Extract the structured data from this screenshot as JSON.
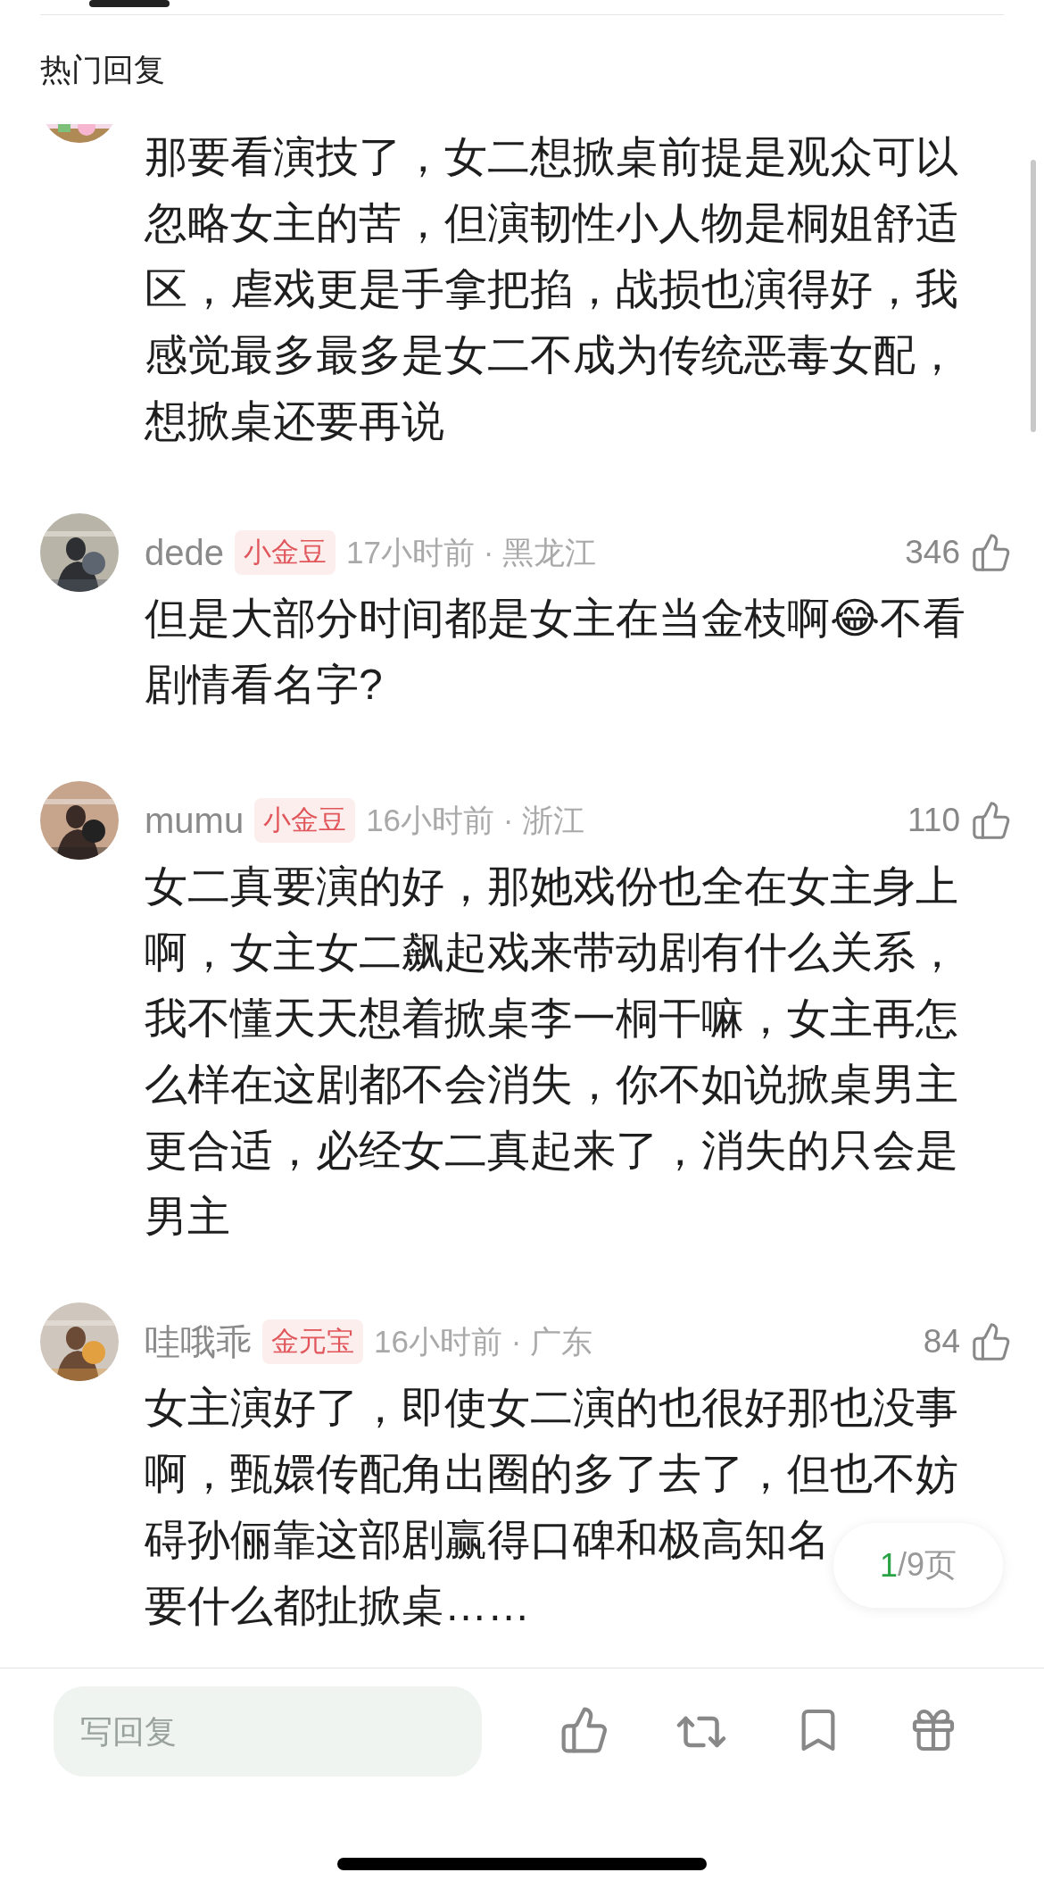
{
  "section_title": "热门回复",
  "comments": [
    {
      "kind": "partial",
      "body": [
        "那要看演技了，女二想掀桌前提是观众可以忽略女主的苦，但演韧性小人物是桐姐舒适区，虐戏更是手拿把掐，战损也演得好，我感觉最多最多是女二不成为传统恶毒女配，想掀桌还要再说"
      ]
    },
    {
      "kind": "full",
      "name": "dede",
      "badge": "小金豆",
      "meta": "17小时前 · 黑龙江",
      "likes": "346",
      "body": [
        "但是大部分时间都是女主在当金枝啊😂不看剧情看名字?"
      ]
    },
    {
      "kind": "full",
      "name": "mumu",
      "badge": "小金豆",
      "meta": "16小时前 · 浙江",
      "likes": "110",
      "body": [
        "女二真要演的好，那她戏份也全在女主身上啊，女主女二飙起戏来带动剧有什么关系，我不懂天天想着掀桌李一桐干嘛，女主再怎么样在这剧都不会消失，你不如说掀桌男主更合适，必经女二真起来了，消失的只会是男主"
      ]
    },
    {
      "kind": "full",
      "name": "哇哦乖",
      "badge": "金元宝",
      "meta": "16小时前 · 广东",
      "likes": "84",
      "body": [
        "女主演好了，即使女二演的也很好那也没事啊，甄嬛传配角出圈的多了去了，但也不妨",
        "碍孙俪靠这部剧赢得口碑和极高知名",
        "要什么都扯掀桌……"
      ]
    }
  ],
  "page_indicator": {
    "current": "1",
    "total": "/9页"
  },
  "reply_box": {
    "placeholder": "写回复"
  }
}
